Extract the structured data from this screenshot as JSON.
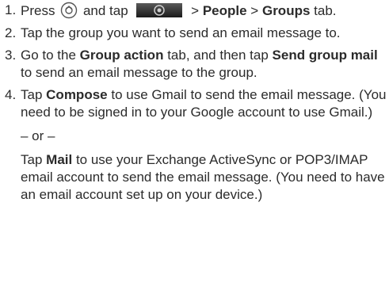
{
  "steps": [
    {
      "number": "1.",
      "press": "Press",
      "and_tap": "and tap",
      "gt1": ">",
      "people": "People",
      "gt2": ">",
      "groups": "Groups",
      "tab": "tab."
    },
    {
      "number": "2.",
      "text": "Tap the group you want to send an email message to."
    },
    {
      "number": "3.",
      "go_to": "Go to the",
      "group_action": "Group action",
      "tab_then_tap": "tab, and then tap",
      "send_group_mail": "Send group mail",
      "rest": "to send an email message to the group."
    },
    {
      "number": "4.",
      "tap": "Tap",
      "compose": "Compose",
      "rest": "to use Gmail to send the email message. (You need to be signed in to your Google account to use Gmail.)",
      "or": "– or –",
      "tap2": "Tap",
      "mail": "Mail",
      "rest2": "to use your Exchange ActiveSync or POP3/IMAP email account to send the email message. (You need to have an email account set up on your device.)"
    }
  ]
}
